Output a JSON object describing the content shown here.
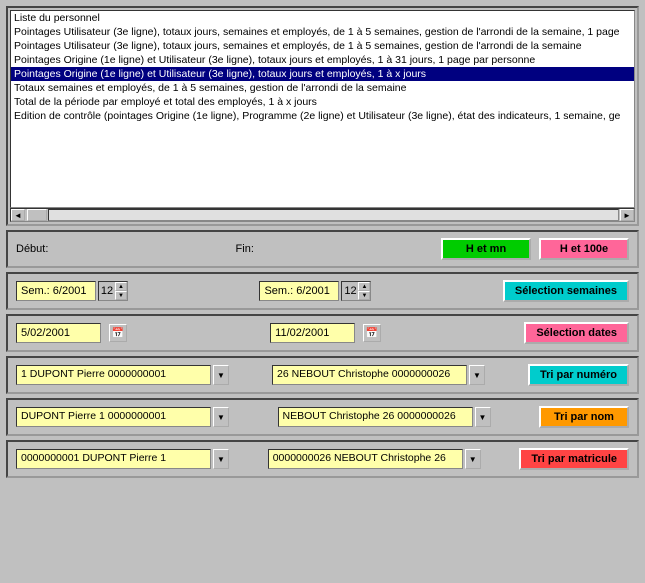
{
  "listSection": {
    "items": [
      {
        "text": "Liste du personnel",
        "selected": false
      },
      {
        "text": "Pointages Utilisateur (3e ligne), totaux jours, semaines et employés, de 1 à 5 semaines, gestion de l'arrondi de la semaine, 1 page",
        "selected": false
      },
      {
        "text": "Pointages Utilisateur (3e ligne), totaux jours, semaines et employés, de 1 à 5 semaines, gestion de l'arrondi de la semaine",
        "selected": false
      },
      {
        "text": "Pointages Origine (1e ligne) et Utilisateur (3e ligne), totaux jours et employés, 1 à 31 jours, 1 page par personne",
        "selected": false
      },
      {
        "text": "Pointages Origine (1e ligne) et Utilisateur (3e ligne), totaux jours et employés, 1 à x jours",
        "selected": true
      },
      {
        "text": "Totaux semaines et employés, de 1 à 5 semaines, gestion de l'arrondi de la semaine",
        "selected": false
      },
      {
        "text": "Total de la période par employé et total des employés, 1 à x jours",
        "selected": false
      },
      {
        "text": "Edition de contrôle (pointages Origine (1e ligne), Programme (2e ligne) et Utilisateur (3e ligne), état des indicateurs, 1 semaine, ge",
        "selected": false
      }
    ]
  },
  "hRow": {
    "debutLabel": "Début:",
    "finLabel": "Fin:",
    "btnHMnLabel": "H et mn",
    "btn100eLabel": "H et 100e"
  },
  "semRow": {
    "sem1Label": "Sem.: 6/2001",
    "sem1Spin": "12",
    "sem2Label": "Sem.: 6/2001",
    "sem2Spin": "12",
    "btnLabel": "Sélection semaines"
  },
  "dateRow": {
    "date1": "5/02/2001",
    "date2": "11/02/2001",
    "btnLabel": "Sélection dates"
  },
  "numRow": {
    "val1": "1 DUPONT Pierre 0000000001",
    "val2": "26 NEBOUT Christophe 0000000026",
    "btnLabel": "Tri par numéro"
  },
  "nomRow": {
    "val1": "DUPONT Pierre 1 0000000001",
    "val2": "NEBOUT Christophe 26 0000000026",
    "btnLabel": "Tri par nom"
  },
  "matRow": {
    "val1": "0000000001 DUPONT Pierre 1",
    "val2": "0000000026 NEBOUT Christophe 26",
    "btnLabel": "Tri par matricule"
  }
}
